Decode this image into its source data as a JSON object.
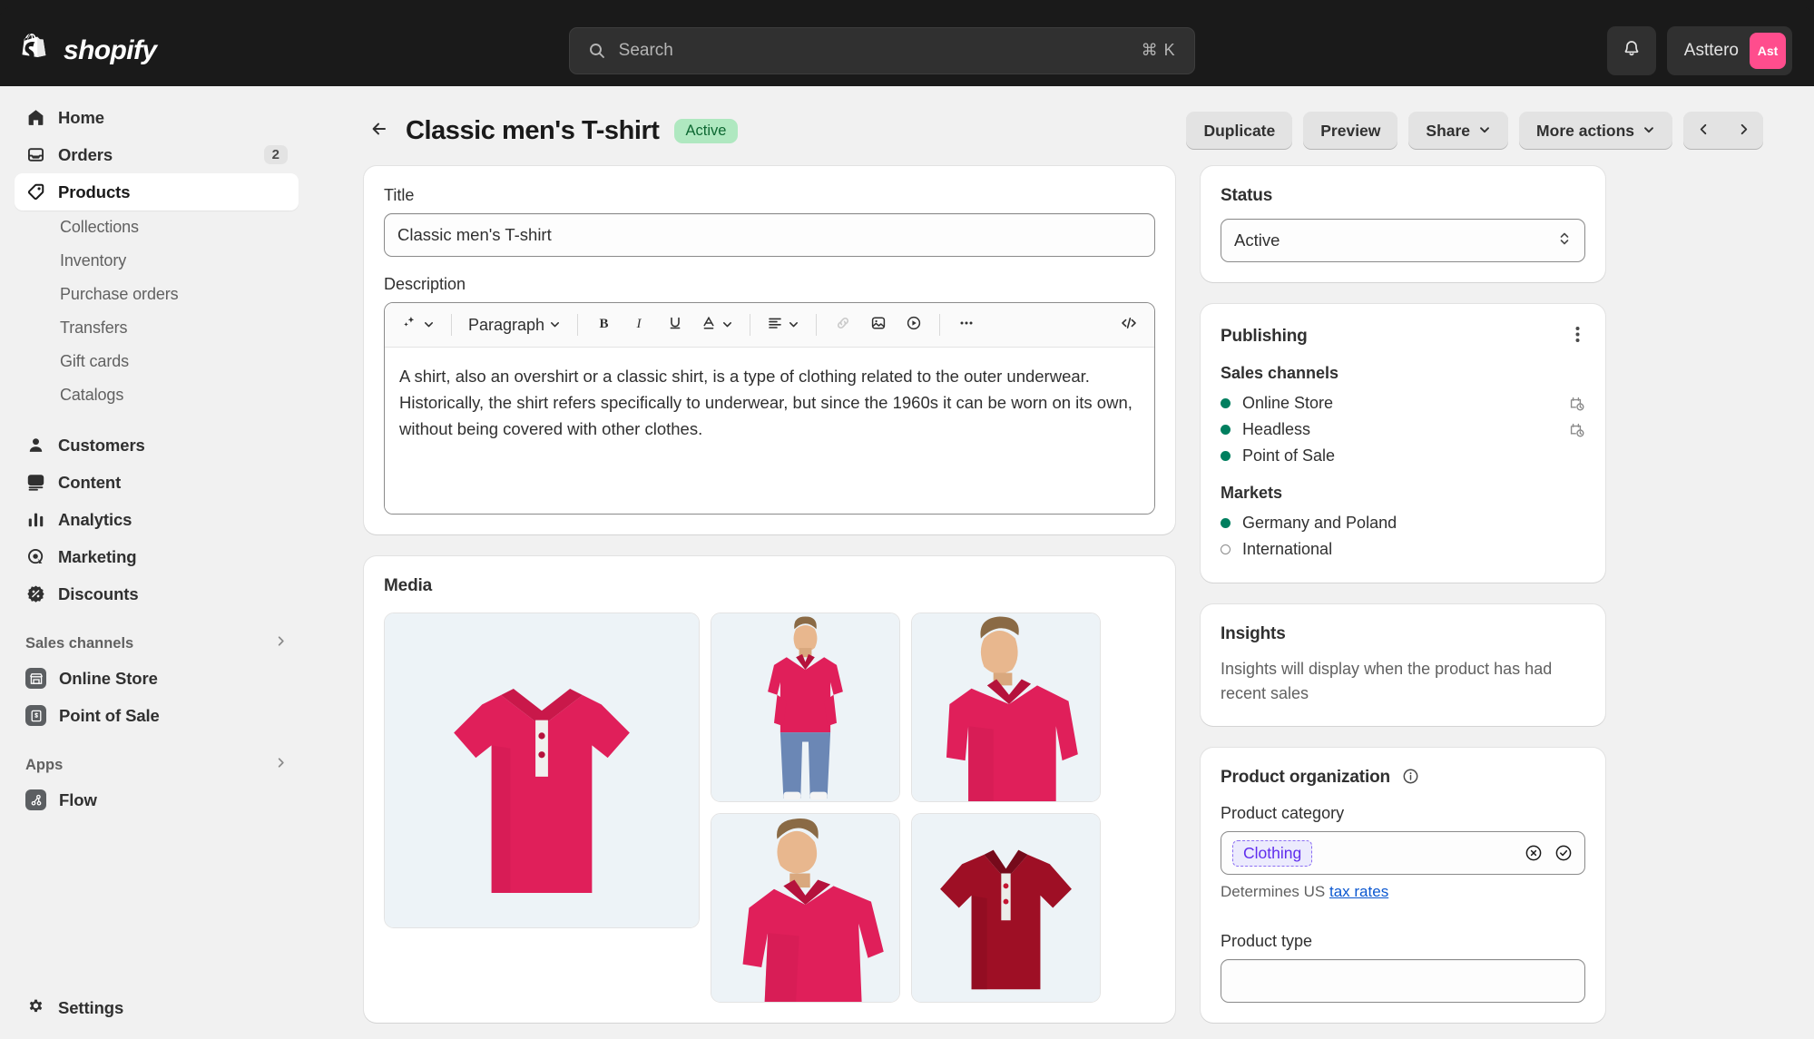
{
  "topbar": {
    "brand_name": "shopify",
    "search": {
      "placeholder": "Search",
      "shortcut": "⌘ K"
    },
    "notifications_icon": "bell-icon",
    "user": {
      "name": "Asttero",
      "initials": "Ast"
    }
  },
  "sidebar": {
    "items": [
      {
        "label": "Home",
        "icon": "home-icon"
      },
      {
        "label": "Orders",
        "icon": "orders-icon",
        "badge": "2"
      },
      {
        "label": "Products",
        "icon": "tag-icon",
        "active": true
      }
    ],
    "product_subitems": [
      {
        "label": "Collections"
      },
      {
        "label": "Inventory"
      },
      {
        "label": "Purchase orders"
      },
      {
        "label": "Transfers"
      },
      {
        "label": "Gift cards"
      },
      {
        "label": "Catalogs"
      }
    ],
    "items2": [
      {
        "label": "Customers",
        "icon": "person-icon"
      },
      {
        "label": "Content",
        "icon": "content-icon"
      },
      {
        "label": "Analytics",
        "icon": "analytics-icon"
      },
      {
        "label": "Marketing",
        "icon": "marketing-icon"
      },
      {
        "label": "Discounts",
        "icon": "discount-icon"
      }
    ],
    "sales_channels_group": {
      "title": "Sales channels",
      "items": [
        {
          "label": "Online Store",
          "icon": "store-icon"
        },
        {
          "label": "Point of Sale",
          "icon": "pos-icon"
        }
      ]
    },
    "apps_group": {
      "title": "Apps",
      "items": [
        {
          "label": "Flow",
          "icon": "flow-icon"
        }
      ]
    },
    "settings": {
      "label": "Settings",
      "icon": "gear-icon"
    }
  },
  "page": {
    "back_icon": "arrow-left-icon",
    "title": "Classic men's T-shirt",
    "status_badge": "Active",
    "actions": {
      "duplicate": "Duplicate",
      "preview": "Preview",
      "share": "Share",
      "more_actions": "More actions"
    }
  },
  "product": {
    "title_label": "Title",
    "title_value": "Classic men's T-shirt",
    "description_label": "Description",
    "description_text": "A shirt, also an overshirt or a classic shirt, is a type of clothing related to the outer underwear. Historically, the shirt refers specifically to underwear, but since the 1960s it can be worn on its own, without being covered with other clothes.",
    "editor_toolbar": {
      "ai": "ai-sparkle-icon",
      "block_format": "Paragraph",
      "bold": "bold-icon",
      "italic": "italic-icon",
      "underline": "underline-icon",
      "text_color": "text-color-icon",
      "align": "align-left-icon",
      "link": "link-icon",
      "image": "image-icon",
      "video": "video-icon",
      "more": "ellipsis-icon",
      "code": "code-icon"
    },
    "media_label": "Media",
    "media_items": [
      {
        "alt": "Pink polo shirt flat lay",
        "kind": "main"
      },
      {
        "alt": "Model wearing pink polo with blue jeans",
        "kind": "thumb"
      },
      {
        "alt": "Model in pink polo side view",
        "kind": "thumb"
      },
      {
        "alt": "Model in pink polo back view",
        "kind": "thumb"
      },
      {
        "alt": "Dark red polo shirt flat lay",
        "kind": "thumb"
      }
    ]
  },
  "status_card": {
    "title": "Status",
    "value": "Active"
  },
  "publishing_card": {
    "title": "Publishing",
    "menu_icon": "kebab-menu-icon",
    "sales_channels_title": "Sales channels",
    "sales_channels": [
      {
        "label": "Online Store",
        "published": true,
        "has_schedule": true
      },
      {
        "label": "Headless",
        "published": true,
        "has_schedule": true
      },
      {
        "label": "Point of Sale",
        "published": true,
        "has_schedule": false
      }
    ],
    "markets_title": "Markets",
    "markets": [
      {
        "label": "Germany and Poland",
        "published": true
      },
      {
        "label": "International",
        "published": false
      }
    ]
  },
  "insights_card": {
    "title": "Insights",
    "body": "Insights will display when the product has had recent sales"
  },
  "organization_card": {
    "title": "Product organization",
    "info_icon": "info-icon",
    "category_label": "Product category",
    "category_value": "Clothing",
    "clear_icon": "clear-circle-icon",
    "confirm_icon": "check-circle-icon",
    "helper_prefix": "Determines US",
    "helper_link": "tax rates",
    "type_label": "Product type"
  },
  "colors": {
    "brand_dark": "#1a1a1a",
    "surface": "#f1f1f1",
    "accent_pink": "#ff4d8d",
    "success_green": "#007f5f",
    "badge_green_bg": "#afe8c0",
    "badge_green_text": "#0d6832",
    "tag_purple": "#5f2ded",
    "link_blue": "#0b57d0"
  }
}
